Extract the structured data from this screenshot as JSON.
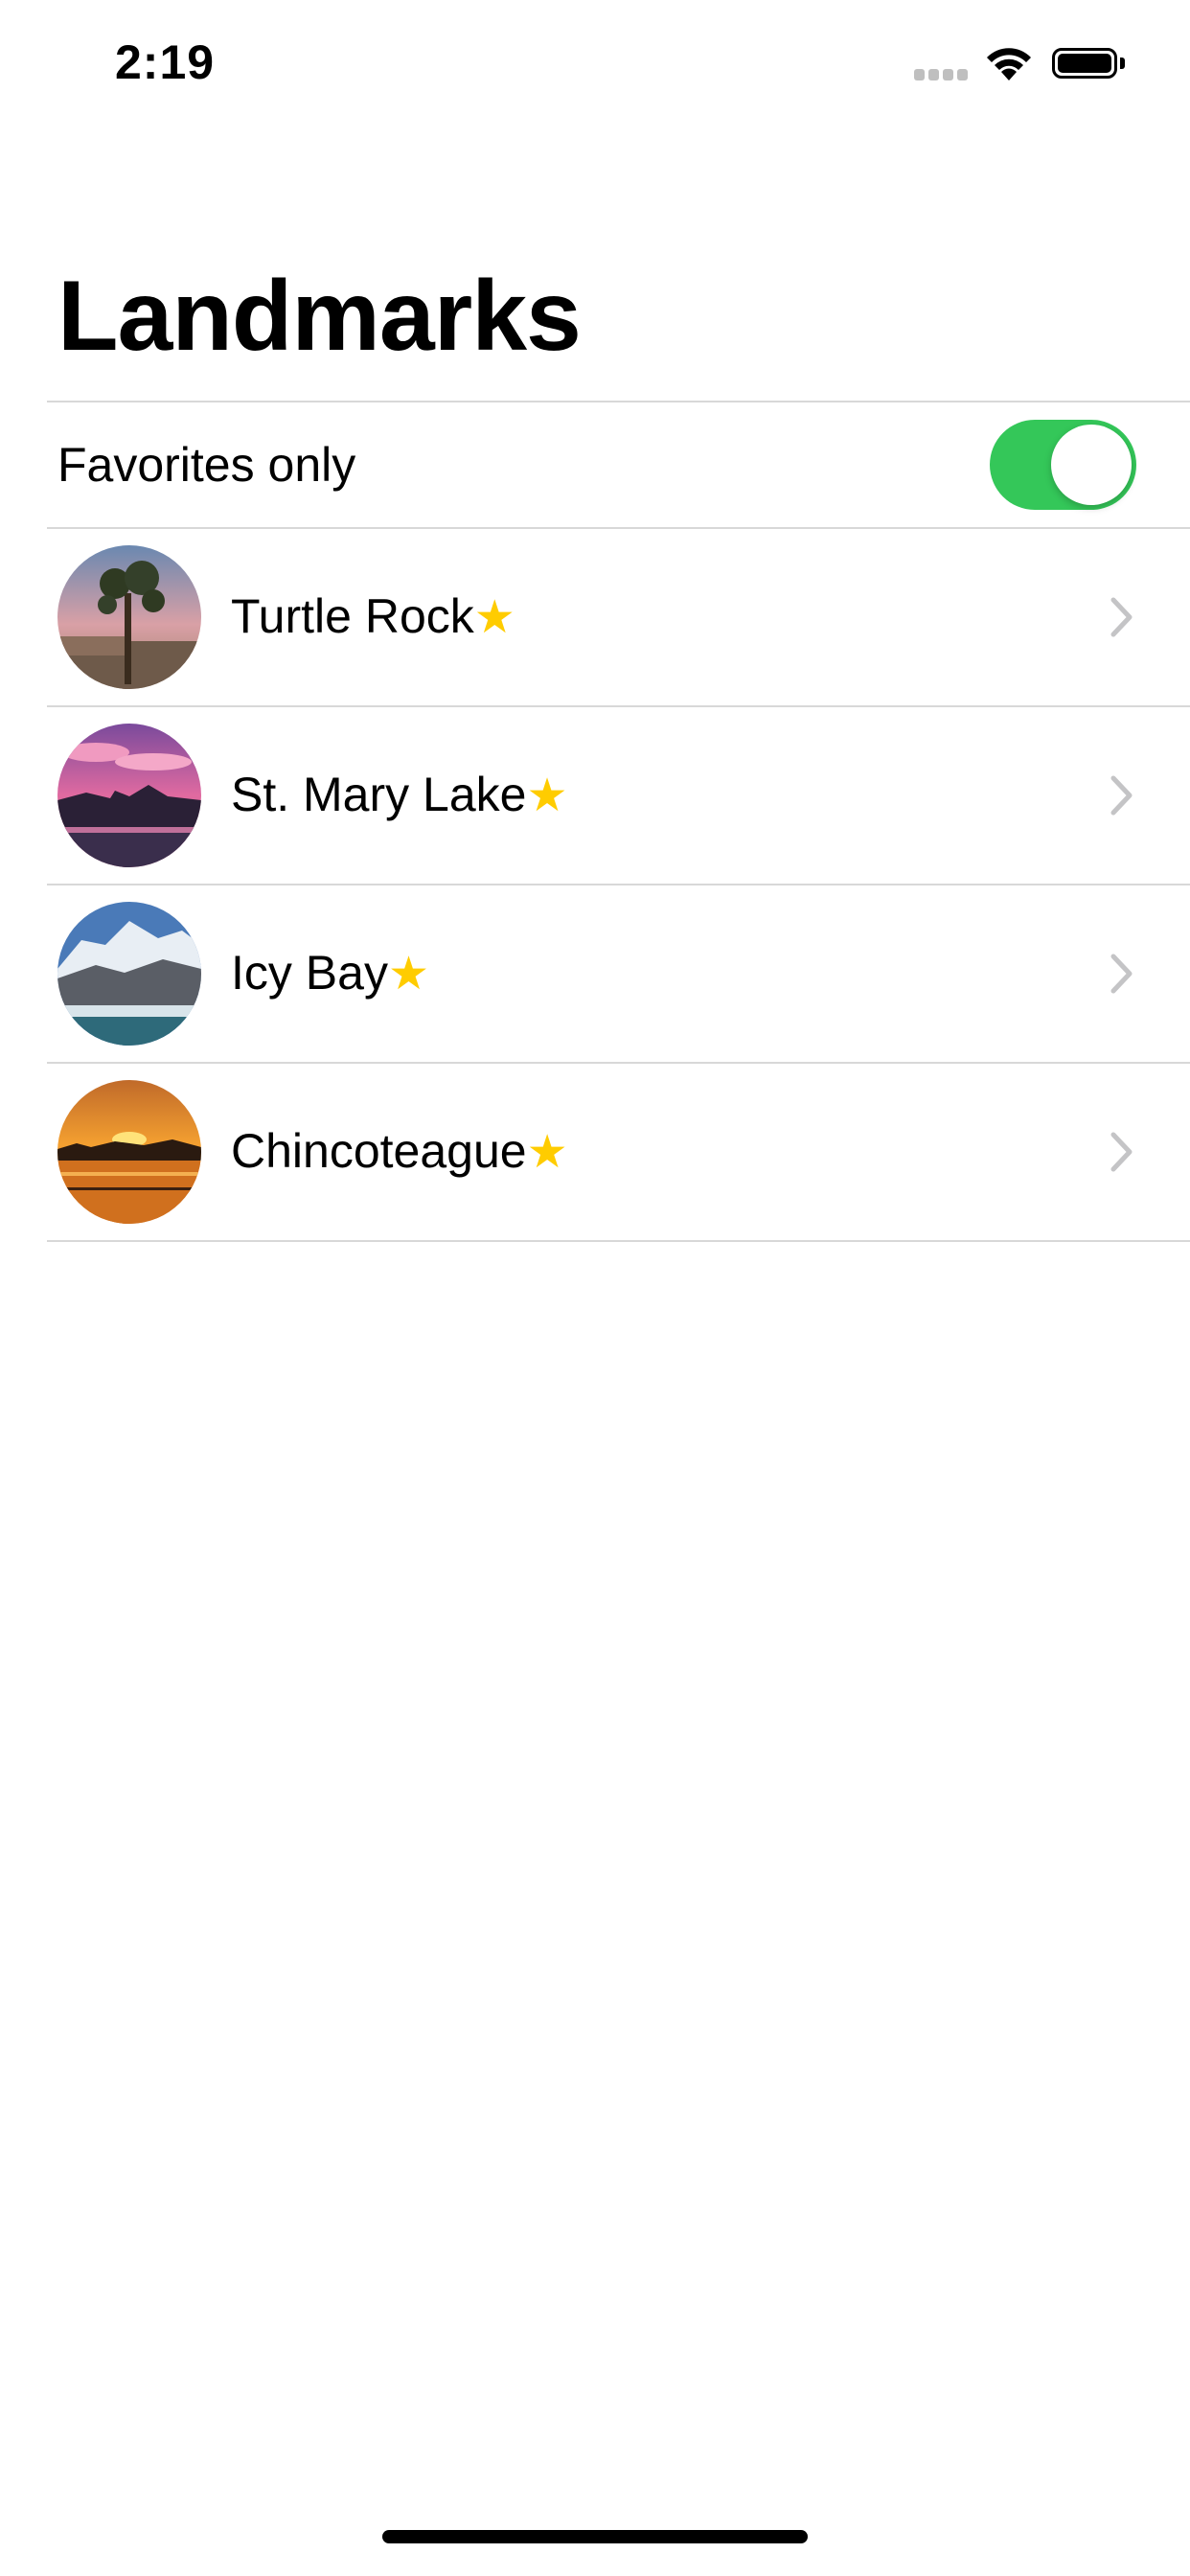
{
  "status_bar": {
    "time": "2:19",
    "icons": [
      "cellular-signal-icon",
      "wifi-icon",
      "battery-icon"
    ]
  },
  "navigation": {
    "title": "Landmarks"
  },
  "filter": {
    "label": "Favorites only",
    "toggle_on": true,
    "toggle_color": "#34c759"
  },
  "landmarks": [
    {
      "name": "Turtle Rock",
      "favorite_icon": "star-icon"
    },
    {
      "name": "St. Mary Lake",
      "favorite_icon": "star-icon"
    },
    {
      "name": "Icy Bay",
      "favorite_icon": "star-icon"
    },
    {
      "name": "Chincoteague",
      "favorite_icon": "star-icon"
    }
  ],
  "colors": {
    "star": "#ffcc00",
    "chevron": "#c4c4c6",
    "separator": "#d8d8d8"
  },
  "star_glyph": "★"
}
